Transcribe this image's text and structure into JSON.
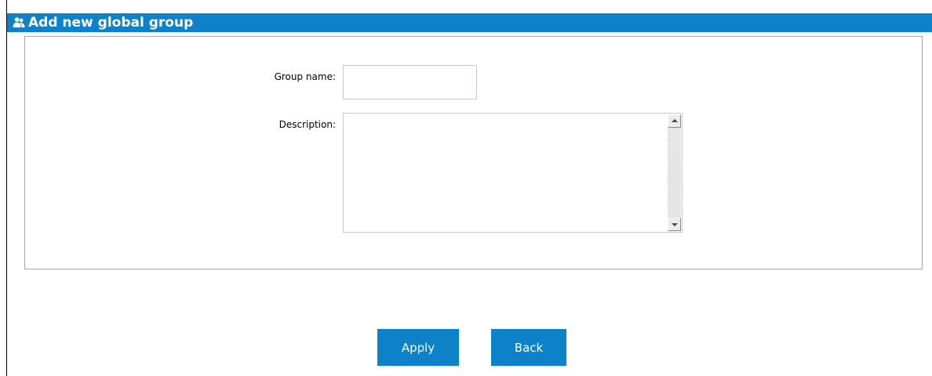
{
  "header": {
    "title": "Add new global group",
    "icon": "user-group-icon"
  },
  "form": {
    "group_name": {
      "label": "Group name:",
      "value": ""
    },
    "description": {
      "label": "Description:",
      "value": ""
    }
  },
  "actions": {
    "apply_label": "Apply",
    "back_label": "Back"
  },
  "colors": {
    "accent": "#0d82c9",
    "panel_border": "#a6a6a6"
  }
}
